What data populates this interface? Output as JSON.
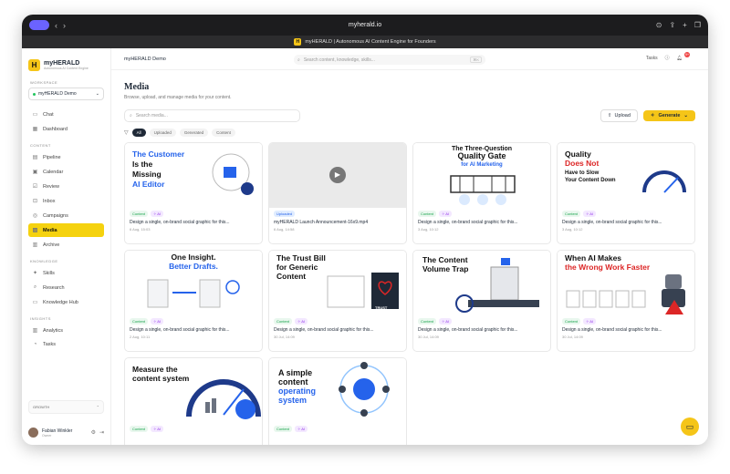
{
  "browser": {
    "url": "myherald.io",
    "tab_title": "myHERALD | Autonomous AI Content Engine for Founders"
  },
  "sidebar": {
    "brand": "myHERALD",
    "brand_sub": "Autonomous AI Content Engine",
    "workspace_label": "WORKSPACE",
    "workspace": "myHERALD Demo",
    "items_top": [
      {
        "label": "Chat"
      },
      {
        "label": "Dashboard"
      }
    ],
    "content_label": "CONTENT",
    "items_content": [
      {
        "label": "Pipeline"
      },
      {
        "label": "Calendar"
      },
      {
        "label": "Review"
      },
      {
        "label": "Inbox"
      },
      {
        "label": "Campaigns"
      },
      {
        "label": "Media"
      },
      {
        "label": "Archive"
      }
    ],
    "knowledge_label": "KNOWLEDGE",
    "items_knowledge": [
      {
        "label": "Skills"
      },
      {
        "label": "Research"
      },
      {
        "label": "Knowledge Hub"
      }
    ],
    "insights_label": "INSIGHTS",
    "items_insights": [
      {
        "label": "Analytics"
      },
      {
        "label": "Tasks"
      }
    ],
    "plan": "GROWTH",
    "user": {
      "name": "Fabian Winkler",
      "role": "Owner"
    }
  },
  "topbar": {
    "workspace": "myHERALD Demo",
    "search_placeholder": "Search content, knowledge, skills...",
    "shortcut": "⌘K",
    "tasks": "Tasks",
    "notifications": "9+"
  },
  "page": {
    "title": "Media",
    "subtitle": "Browse, upload, and manage media for your content.",
    "search_placeholder": "Search media...",
    "upload": "Upload",
    "generate": "Generate"
  },
  "filters": [
    "All",
    "Uploaded",
    "Generated",
    "Content"
  ],
  "cards": [
    {
      "t1": "The Customer",
      "t2": "Is the",
      "t3": "Missing",
      "t4": "AI Editor",
      "tags": [
        "Content",
        "AI"
      ],
      "title": "Design a single, on-brand social graphic for this...",
      "date": "6 Aug, 15:03"
    },
    {
      "tags": [
        "Uploaded"
      ],
      "title": "myHERALD Launch Announcement-16x9.mp4",
      "date": "6 Aug, 14:58"
    },
    {
      "t1": "The Three-Question",
      "t2": "Quality Gate",
      "t3": "for AI Marketing",
      "tags": [
        "Content",
        "AI"
      ],
      "title": "Design a single, on-brand social graphic for this...",
      "date": "3 Aug, 10:12"
    },
    {
      "t1": "Quality",
      "t2": "Does Not",
      "t3": "Have to Slow",
      "t4": "Your Content Down",
      "tags": [
        "Content",
        "AI"
      ],
      "title": "Design a single, on-brand social graphic for this...",
      "date": "3 Aug, 10:12"
    },
    {
      "t1": "One Insight.",
      "t2": "Better Drafts.",
      "tags": [
        "Content",
        "AI"
      ],
      "title": "Design a single, on-brand social graphic for this...",
      "date": "2 Aug, 10:11"
    },
    {
      "t1": "The Trust Bill",
      "t2": "for Generic",
      "t3": "Content",
      "tags": [
        "Content",
        "AI"
      ],
      "title": "Design a single, on-brand social graphic for this...",
      "date": "30 Jul, 14:09",
      "trust": "TRUST"
    },
    {
      "t1": "The Content",
      "t2": "Volume Trap",
      "tags": [
        "Content",
        "AI"
      ],
      "title": "Design a single, on-brand social graphic for this...",
      "date": "30 Jul, 14:09"
    },
    {
      "t1": "When AI Makes",
      "t2": "the Wrong Work Faster",
      "tags": [
        "Content",
        "AI"
      ],
      "title": "Design a single, on-brand social graphic for this...",
      "date": "30 Jul, 14:09"
    },
    {
      "t1": "Measure the",
      "t2": "content system",
      "tags": [
        "Content",
        "AI"
      ],
      "title": "",
      "date": ""
    },
    {
      "t1": "A simple",
      "t2": "content",
      "t3": "operating",
      "t4": "system",
      "tags": [
        "Content",
        "AI"
      ],
      "title": "",
      "date": ""
    }
  ]
}
